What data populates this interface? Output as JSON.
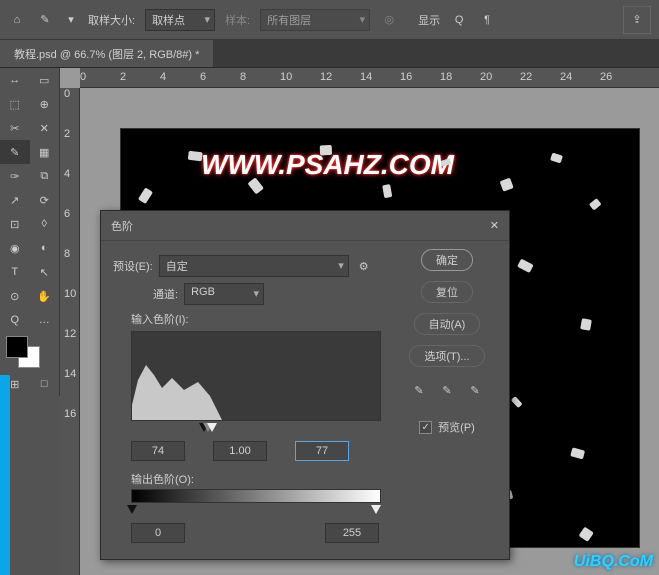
{
  "topbar": {
    "sample_label": "取样大小:",
    "sample_value": "取样点",
    "sample2_label": "样本:",
    "sample2_value": "所有图层",
    "show_label": "显示",
    "home_glyph": "⌂",
    "eyedrop_glyph": "✎",
    "share_glyph": "⇪"
  },
  "tab": {
    "title": "教程.psd @ 66.7% (图层 2, RGB/8#) *"
  },
  "ruler_h": [
    "0",
    "2",
    "4",
    "6",
    "8",
    "10",
    "12",
    "14",
    "16",
    "18",
    "20",
    "22",
    "24",
    "26"
  ],
  "ruler_v": [
    "0",
    "2",
    "4",
    "6",
    "8",
    "10",
    "12",
    "14",
    "16"
  ],
  "canvas": {
    "watermark": "WWW.PSAHZ.COM"
  },
  "dialog": {
    "title": "色阶",
    "preset_label": "预设(E):",
    "preset_value": "自定",
    "gear": "⚙",
    "channel_label": "通道:",
    "channel_value": "RGB",
    "input_label": "输入色阶(I):",
    "shadow": "74",
    "mid": "1.00",
    "highlight": "77",
    "output_label": "输出色阶(O):",
    "out_shadow": "0",
    "out_highlight": "255",
    "ok": "确定",
    "cancel": "复位",
    "auto": "自动(A)",
    "options": "选项(T)...",
    "preview": "预览(P)",
    "check": "✓",
    "close": "✕"
  },
  "brand": "UiBQ.CoM",
  "tools": [
    [
      "↔",
      "▭"
    ],
    [
      "⬚",
      "⊕"
    ],
    [
      "✂",
      "✕"
    ],
    [
      "✎",
      "▦"
    ],
    [
      "✑",
      "⧉"
    ],
    [
      "↗",
      "⟳"
    ],
    [
      "⊡",
      "◊"
    ],
    [
      "◉",
      "◐"
    ],
    [
      "T",
      "↖"
    ],
    [
      "⊙",
      "✋"
    ],
    [
      "Q",
      "…"
    ]
  ],
  "bottom_tools": [
    "⊞",
    "□"
  ]
}
